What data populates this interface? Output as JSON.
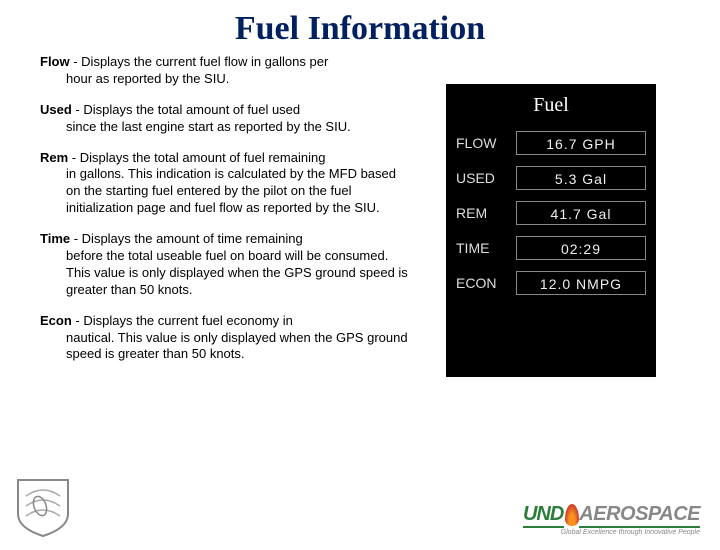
{
  "title": "Fuel Information",
  "entries": [
    {
      "label": "Flow",
      "first": " - Displays the current fuel flow in gallons per",
      "rest": "hour as reported by the SIU."
    },
    {
      "label": "Used",
      "first": " - Displays the total amount of fuel used",
      "rest": "since the last engine start as reported by the SIU."
    },
    {
      "label": "Rem",
      "first": " - Displays the total amount of fuel remaining",
      "rest": "in gallons. This indication is calculated by the MFD based on the starting fuel entered by the pilot on the fuel initialization page and fuel flow as reported by the SIU."
    },
    {
      "label": "Time",
      "first": " - Displays the amount of time remaining",
      "rest": "before the total useable fuel on board will be consumed. This value is only displayed when the GPS ground speed is greater than 50 knots."
    },
    {
      "label": "Econ",
      "first": " - Displays the current fuel economy in",
      "rest": "nautical. This value is only displayed when the GPS ground speed is greater than 50 knots."
    }
  ],
  "panel": {
    "title": "Fuel",
    "rows": [
      {
        "label": "FLOW",
        "value": "16.7 GPH"
      },
      {
        "label": "USED",
        "value": "5.3 Gal"
      },
      {
        "label": "REM",
        "value": "41.7 Gal"
      },
      {
        "label": "TIME",
        "value": "02:29"
      },
      {
        "label": "ECON",
        "value": "12.0 NMPG"
      }
    ]
  },
  "footer": {
    "brand_und": "UND",
    "brand_aero": "AEROSPACE",
    "tagline": "Global Excellence through Innovative People"
  }
}
